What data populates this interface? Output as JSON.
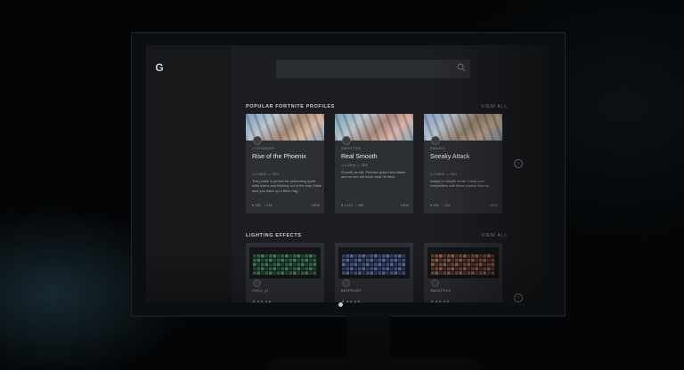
{
  "app": {
    "logo_glyph": "G",
    "logo_icon": "logitech-g-icon"
  },
  "search": {
    "placeholder": "",
    "icon": "search-icon"
  },
  "sections": [
    {
      "title": "POPULAR FORTNITE PROFILES",
      "view_all": "VIEW ALL",
      "cards": [
        {
          "author": "LOGIGAMER",
          "title": "Rise of the Phoenix",
          "meta_left": "0 MINS",
          "meta_right": "SEN",
          "description": "This profile is perfect for performing quick edits slams and blinking out of the way. Make sure you stack up a Blink Dag...",
          "likes": "18K",
          "downloads": "248",
          "view": "VIEW"
        },
        {
          "author": "SMOOTHIE",
          "title": "Real Smooth",
          "meta_left": "0 MINS",
          "meta_right": "SEN",
          "description": "Smooth as silk. Perform quick echo slams and no one will know what hit them.",
          "likes": "1,215",
          "downloads": "985",
          "view": "VIEW"
        },
        {
          "author": "SNEAKY",
          "title": "Sneaky Attack",
          "meta_left": "0 MINS",
          "meta_right": "SEN",
          "description": "Always in stealth mode. Crush your competition with these custom Macros.",
          "likes": "18K",
          "downloads": "248",
          "view": "VIEW"
        }
      ]
    },
    {
      "title": "LIGHTING EFFECTS",
      "view_all": "VIEW ALL",
      "cards": [
        {
          "author": "VVILL_U",
          "extra": "▲ ▲▲ ▲▲"
        },
        {
          "author": "BIGFROST",
          "extra": "▲ ▲▲ ▲▲"
        },
        {
          "author": "SMOOTHIE",
          "extra": "▲ ▲▲ ▲▲"
        }
      ]
    }
  ],
  "colors": {
    "screen_bg": "#1b1d20",
    "card_bg": "#2c2f33",
    "text_primary": "#e6e9ec"
  },
  "keyboard_colors": [
    "#4aa66a",
    "#6f86d8",
    "#d07a55"
  ]
}
